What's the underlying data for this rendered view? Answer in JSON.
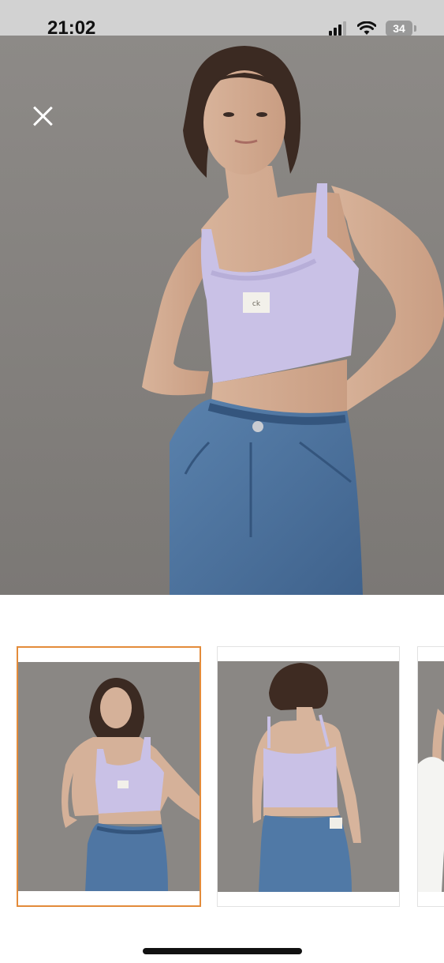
{
  "status_bar": {
    "time": "21:02",
    "battery": "34",
    "icons": [
      "cellular-signal-icon",
      "wifi-icon",
      "battery-icon"
    ]
  },
  "viewer": {
    "close_icon": "close-icon",
    "main_image": "product-photo-front"
  },
  "thumbnails": [
    {
      "name": "product-photo-front",
      "selected": true
    },
    {
      "name": "product-photo-back",
      "selected": false
    },
    {
      "name": "product-photo-side",
      "selected": false
    }
  ],
  "colors": {
    "background": "#ffffff",
    "photo_backdrop": "#85827f",
    "top_lilac": "#c9c1e6",
    "denim": "#4a6f9c",
    "selected_border": "#e38b3a"
  }
}
